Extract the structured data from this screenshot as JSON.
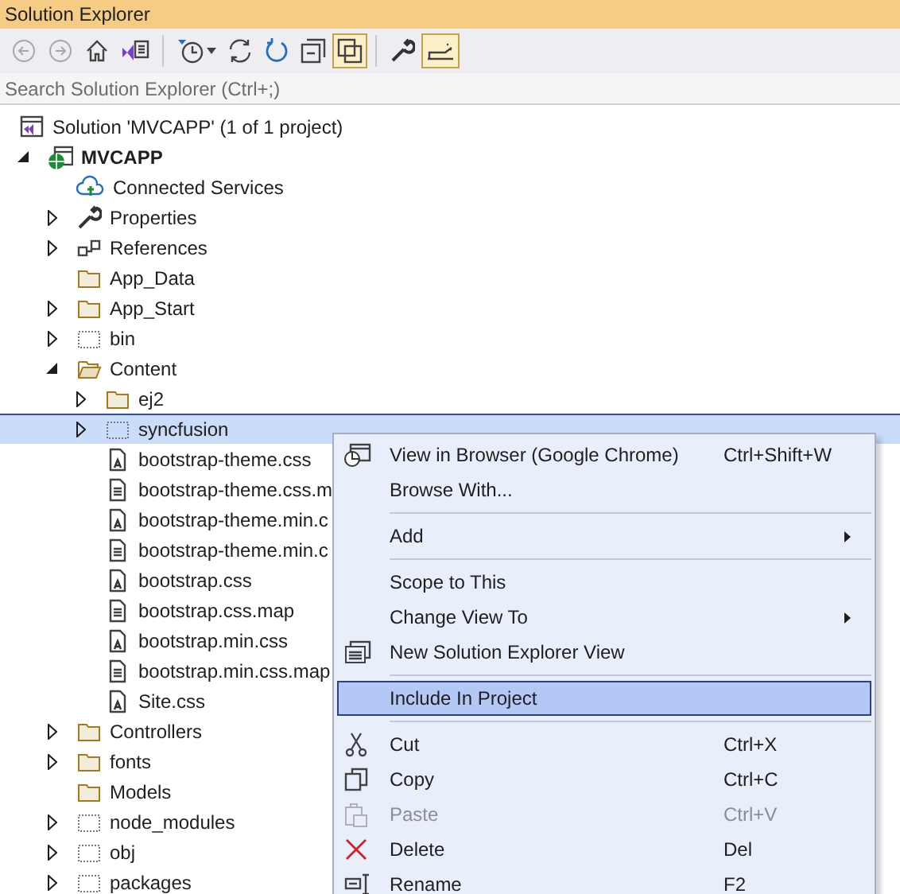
{
  "window": {
    "title": "Solution Explorer"
  },
  "toolbar": [
    {
      "disabled": true,
      "on": false
    },
    {
      "disabled": true,
      "on": false
    },
    {
      "disabled": false,
      "on": false
    },
    {
      "disabled": false,
      "on": false
    },
    {
      "disabled": false,
      "on": false,
      "dropdown": true
    },
    {
      "disabled": false,
      "on": false
    },
    {
      "disabled": false,
      "on": false
    },
    {
      "disabled": false,
      "on": false
    },
    {
      "disabled": false,
      "on": true
    },
    {
      "disabled": false,
      "on": false
    },
    {
      "disabled": false,
      "on": true
    }
  ],
  "search": {
    "placeholder": "Search Solution Explorer (Ctrl+;)"
  },
  "tree": {
    "kind": "solution",
    "label": "Solution 'MVCAPP' (1 of 1 project)",
    "selected": false,
    "children": [
      {
        "kind": "project",
        "label": "MVCAPP",
        "bold": true,
        "expanded": true,
        "selected": false,
        "children": [
          {
            "kind": "service",
            "label": "Connected Services",
            "selected": false
          },
          {
            "kind": "wrench",
            "label": "Properties",
            "expanded": false,
            "selected": false
          },
          {
            "kind": "references",
            "label": "References",
            "expanded": false,
            "selected": false
          },
          {
            "kind": "folder",
            "label": "App_Data",
            "selected": false
          },
          {
            "kind": "folder",
            "label": "App_Start",
            "expanded": false,
            "selected": false
          },
          {
            "kind": "ghost",
            "label": "bin",
            "expanded": false,
            "selected": false
          },
          {
            "kind": "folder-open",
            "label": "Content",
            "expanded": true,
            "selected": false,
            "children": [
              {
                "kind": "folder",
                "label": "ej2",
                "expanded": false,
                "selected": false
              },
              {
                "kind": "ghost",
                "label": "syncfusion",
                "expanded": false,
                "selected": true
              },
              {
                "kind": "css",
                "label": "bootstrap-theme.css",
                "selected": false
              },
              {
                "kind": "text",
                "label": "bootstrap-theme.css.m",
                "selected": false
              },
              {
                "kind": "css",
                "label": "bootstrap-theme.min.c",
                "selected": false
              },
              {
                "kind": "text",
                "label": "bootstrap-theme.min.c",
                "selected": false
              },
              {
                "kind": "css",
                "label": "bootstrap.css",
                "selected": false
              },
              {
                "kind": "text",
                "label": "bootstrap.css.map",
                "selected": false
              },
              {
                "kind": "css",
                "label": "bootstrap.min.css",
                "selected": false
              },
              {
                "kind": "text",
                "label": "bootstrap.min.css.map",
                "selected": false
              },
              {
                "kind": "css",
                "label": "Site.css",
                "selected": false
              }
            ]
          },
          {
            "kind": "folder",
            "label": "Controllers",
            "expanded": false,
            "selected": false
          },
          {
            "kind": "folder",
            "label": "fonts",
            "expanded": false,
            "selected": false
          },
          {
            "kind": "folder",
            "label": "Models",
            "selected": false
          },
          {
            "kind": "ghost",
            "label": "node_modules",
            "expanded": false,
            "selected": false
          },
          {
            "kind": "ghost",
            "label": "obj",
            "expanded": false,
            "selected": false
          },
          {
            "kind": "ghost",
            "label": "packages",
            "expanded": false,
            "selected": false
          }
        ]
      }
    ]
  },
  "context_menu": {
    "groups": [
      [
        {
          "label": "View in Browser (Google Chrome)",
          "shortcut": "Ctrl+Shift+W",
          "selected": false,
          "disabled": false
        },
        {
          "label": "Browse With...",
          "selected": false,
          "disabled": false
        }
      ],
      [
        {
          "label": "Add",
          "submenu": true,
          "selected": false,
          "disabled": false
        }
      ],
      [
        {
          "label": "Scope to This",
          "selected": false,
          "disabled": false
        },
        {
          "label": "Change View To",
          "submenu": true,
          "selected": false,
          "disabled": false
        },
        {
          "label": "New Solution Explorer View",
          "selected": false,
          "disabled": false
        }
      ],
      [
        {
          "label": "Include In Project",
          "selected": true,
          "disabled": false
        }
      ],
      [
        {
          "label": "Cut",
          "shortcut": "Ctrl+X",
          "selected": false,
          "disabled": false
        },
        {
          "label": "Copy",
          "shortcut": "Ctrl+C",
          "selected": false,
          "disabled": false
        },
        {
          "label": "Paste",
          "shortcut": "Ctrl+V",
          "selected": false,
          "disabled": true
        },
        {
          "label": "Delete",
          "shortcut": "Del",
          "selected": false,
          "disabled": false
        },
        {
          "label": "Rename",
          "shortcut": "F2",
          "selected": false,
          "disabled": false
        }
      ]
    ]
  }
}
